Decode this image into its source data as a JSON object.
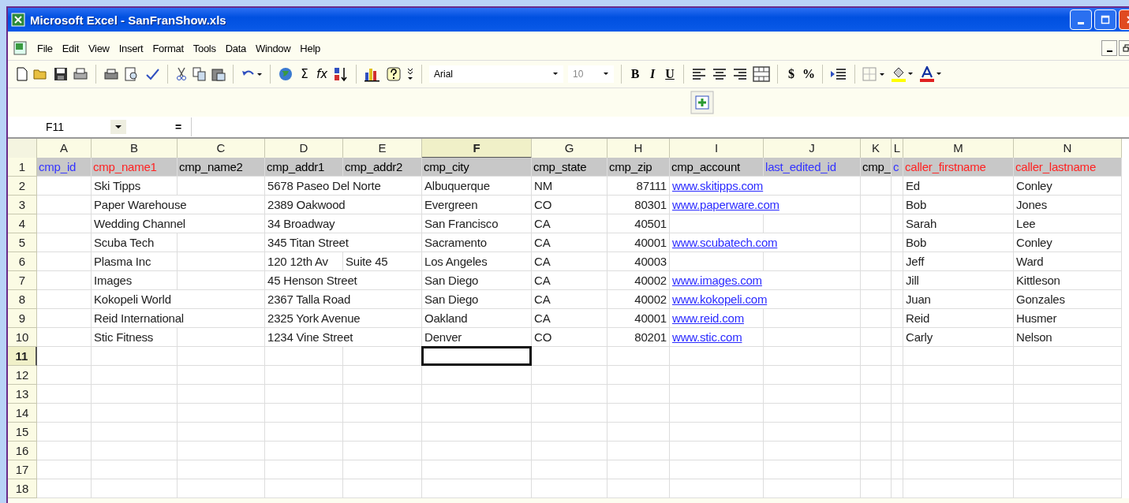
{
  "window": {
    "title": "Microsoft Excel - SanFranShow.xls"
  },
  "menu": [
    "File",
    "Edit",
    "View",
    "Insert",
    "Format",
    "Tools",
    "Data",
    "Window",
    "Help"
  ],
  "toolbar": {
    "sum": "Σ",
    "fx": "fx",
    "font": "Arial",
    "size": "10",
    "bold": "B",
    "italic": "I",
    "underline": "U",
    "currency": "$",
    "percent": "%"
  },
  "formula_bar": {
    "name_box": "F11",
    "equals": "="
  },
  "sheet": {
    "columns": [
      {
        "letter": "A",
        "selected": false
      },
      {
        "letter": "B",
        "selected": false
      },
      {
        "letter": "C",
        "selected": false
      },
      {
        "letter": "D",
        "selected": false
      },
      {
        "letter": "E",
        "selected": false
      },
      {
        "letter": "F",
        "selected": true
      },
      {
        "letter": "G",
        "selected": false
      },
      {
        "letter": "H",
        "selected": false,
        "kind": "number"
      },
      {
        "letter": "I",
        "selected": false,
        "kind": "link"
      },
      {
        "letter": "J",
        "selected": false
      },
      {
        "letter": "K",
        "selected": false
      },
      {
        "letter": "L",
        "selected": false
      },
      {
        "letter": "M",
        "selected": false
      },
      {
        "letter": "N",
        "selected": false
      }
    ],
    "rows": [
      {
        "number": "1",
        "selected": false,
        "kind": "header",
        "cells": [
          {
            "text": "cmp_id",
            "color": "#3333ff"
          },
          {
            "text": "cmp_name1",
            "color": "#ff2222"
          },
          {
            "text": "cmp_name2",
            "color": "#000000"
          },
          {
            "text": "cmp_addr1",
            "color": "#000000"
          },
          {
            "text": "cmp_addr2",
            "color": "#000000"
          },
          {
            "text": "cmp_city",
            "color": "#000000"
          },
          {
            "text": "cmp_state",
            "color": "#000000"
          },
          {
            "text": "cmp_zip",
            "color": "#000000"
          },
          {
            "text": "cmp_account",
            "color": "#000000"
          },
          {
            "text": "last_edited_id",
            "color": "#3333ff"
          },
          {
            "text": "cmp_",
            "color": "#000000"
          },
          {
            "text": "c",
            "color": "#3333ff"
          },
          {
            "text": "caller_firstname",
            "color": "#ff2222"
          },
          {
            "text": "caller_lastname",
            "color": "#ff2222"
          }
        ]
      },
      {
        "number": "2",
        "selected": false,
        "kind": "data",
        "cells": [
          null,
          "Ski Tipps",
          null,
          "5678 Paseo Del Norte",
          null,
          "Albuquerque",
          "NM",
          "87111",
          "www.skitipps.com",
          null,
          null,
          null,
          "Ed",
          "Conley"
        ]
      },
      {
        "number": "3",
        "selected": false,
        "kind": "data",
        "cells": [
          null,
          "Paper Warehouse",
          null,
          "2389 Oakwood",
          null,
          "Evergreen",
          "CO",
          "80301",
          "www.paperware.com",
          null,
          null,
          null,
          "Bob",
          "Jones"
        ]
      },
      {
        "number": "4",
        "selected": false,
        "kind": "data",
        "cells": [
          null,
          "Wedding Channel",
          null,
          "34 Broadway",
          null,
          "San Francisco",
          "CA",
          "40501",
          null,
          null,
          null,
          null,
          "Sarah",
          "Lee"
        ]
      },
      {
        "number": "5",
        "selected": false,
        "kind": "data",
        "cells": [
          null,
          "Scuba Tech",
          null,
          "345 Titan Street",
          null,
          "Sacramento",
          "CA",
          "40001",
          "www.scubatech.com",
          null,
          null,
          null,
          "Bob",
          "Conley"
        ]
      },
      {
        "number": "6",
        "selected": false,
        "kind": "data",
        "cells": [
          null,
          "Plasma Inc",
          null,
          "120 12th Av",
          "Suite 45",
          "Los Angeles",
          "CA",
          "40003",
          null,
          null,
          null,
          null,
          "Jeff",
          "Ward"
        ]
      },
      {
        "number": "7",
        "selected": false,
        "kind": "data",
        "cells": [
          null,
          "Images",
          null,
          "45 Henson Street",
          null,
          "San Diego",
          "CA",
          "40002",
          "www.images.com",
          null,
          null,
          null,
          "Jill",
          "Kittleson"
        ]
      },
      {
        "number": "8",
        "selected": false,
        "kind": "data",
        "cells": [
          null,
          "Kokopeli World",
          null,
          "2367 Talla Road",
          null,
          "San Diego",
          "CA",
          "40002",
          "www.kokopeli.com",
          null,
          null,
          null,
          "Juan",
          "Gonzales"
        ]
      },
      {
        "number": "9",
        "selected": false,
        "kind": "data",
        "cells": [
          null,
          "Reid International",
          null,
          "2325 York Avenue",
          null,
          "Oakland",
          "CA",
          "40001",
          "www.reid.com",
          null,
          null,
          null,
          "Reid",
          "Husmer"
        ]
      },
      {
        "number": "10",
        "selected": false,
        "kind": "data",
        "cells": [
          null,
          "Stic Fitness",
          null,
          "1234 Vine Street",
          null,
          "Denver",
          "CO",
          "80201",
          "www.stic.com",
          null,
          null,
          null,
          "Carly",
          "Nelson"
        ]
      },
      {
        "number": "11",
        "selected": true,
        "kind": "data"
      },
      {
        "number": "12",
        "selected": false,
        "kind": "data"
      },
      {
        "number": "13",
        "selected": false,
        "kind": "data"
      },
      {
        "number": "14",
        "selected": false,
        "kind": "data"
      },
      {
        "number": "15",
        "selected": false,
        "kind": "data"
      },
      {
        "number": "16",
        "selected": false,
        "kind": "data"
      },
      {
        "number": "17",
        "selected": false,
        "kind": "data"
      },
      {
        "number": "18",
        "selected": false,
        "kind": "data"
      }
    ]
  }
}
